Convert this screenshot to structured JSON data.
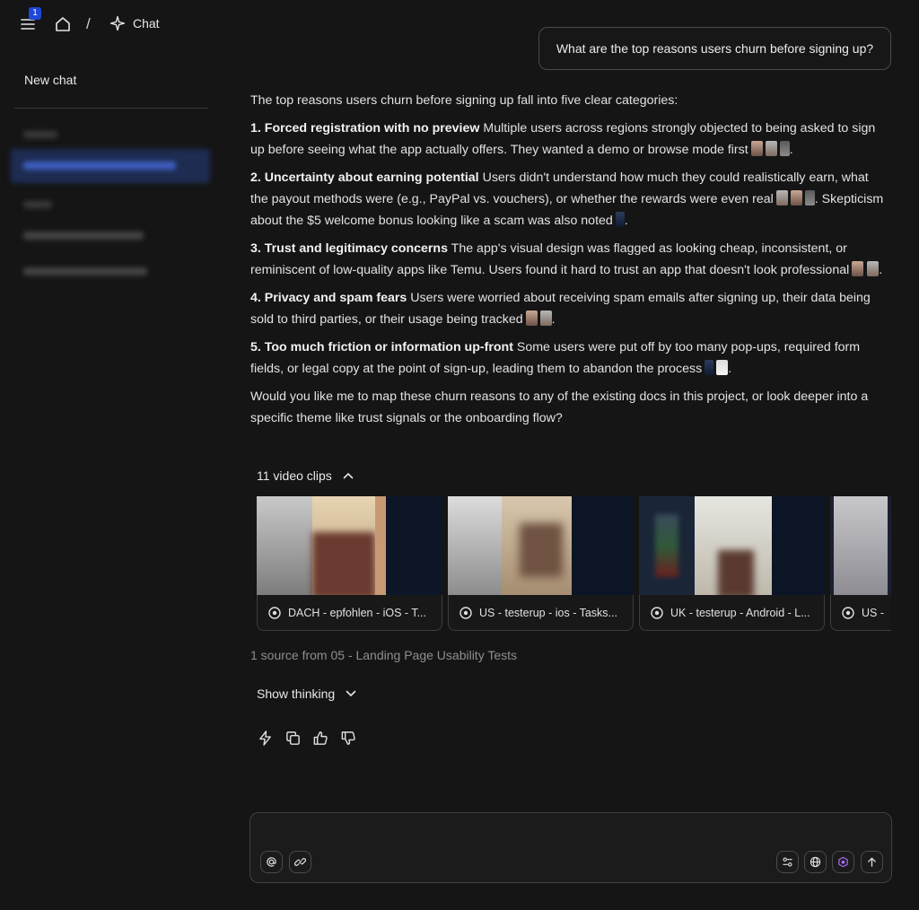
{
  "topbar": {
    "badge_count": "1",
    "separator": "/",
    "crumb_label": "Chat"
  },
  "sidebar": {
    "new_chat_label": "New chat"
  },
  "user_message": "What are the top reasons users churn before signing up?",
  "answer": {
    "intro": "The top reasons users churn before signing up fall into five clear categories:",
    "items": [
      {
        "title": "1. Forced registration with no preview",
        "body": " Multiple users across regions strongly objected to being asked to sign up before seeing what the app actually offers. They wanted a demo or browse mode first"
      },
      {
        "title": "2. Uncertainty about earning potential",
        "body": " Users didn't understand how much they could realistically earn, what the payout methods were (e.g., PayPal vs. vouchers), or whether the rewards were even real",
        "extra": "Skepticism about the $5 welcome bonus looking like a scam was also noted"
      },
      {
        "title": "3. Trust and legitimacy concerns",
        "body": " The app's visual design was flagged as looking cheap, inconsistent, or reminiscent of low-quality apps like Temu. Users found it hard to trust an app that doesn't look professional"
      },
      {
        "title": "4. Privacy and spam fears",
        "body": " Users were worried about receiving spam emails after signing up, their data being sold to third parties, or their usage being tracked"
      },
      {
        "title": "5. Too much friction or information up-front",
        "body": " Some users were put off by too many pop-ups, required form fields, or legal copy at the point of sign-up, leading them to abandon the process"
      }
    ],
    "outro": "Would you like me to map these churn reasons to any of the existing docs in this project, or look deeper into a specific theme like trust signals or the onboarding flow?"
  },
  "clips": {
    "header": "11 video clips",
    "items": [
      {
        "label": "DACH - epfohlen - iOS - T..."
      },
      {
        "label": "US - testerup - ios - Tasks..."
      },
      {
        "label": "UK - testerup - Android - L..."
      },
      {
        "label": "US - "
      }
    ]
  },
  "source_line": "1 source from 05 - Landing Page Usability Tests",
  "show_thinking": "Show thinking",
  "composer": {
    "placeholder": ""
  },
  "colors": {
    "background": "#151515",
    "accent": "#1f47d6",
    "border": "#404040"
  }
}
